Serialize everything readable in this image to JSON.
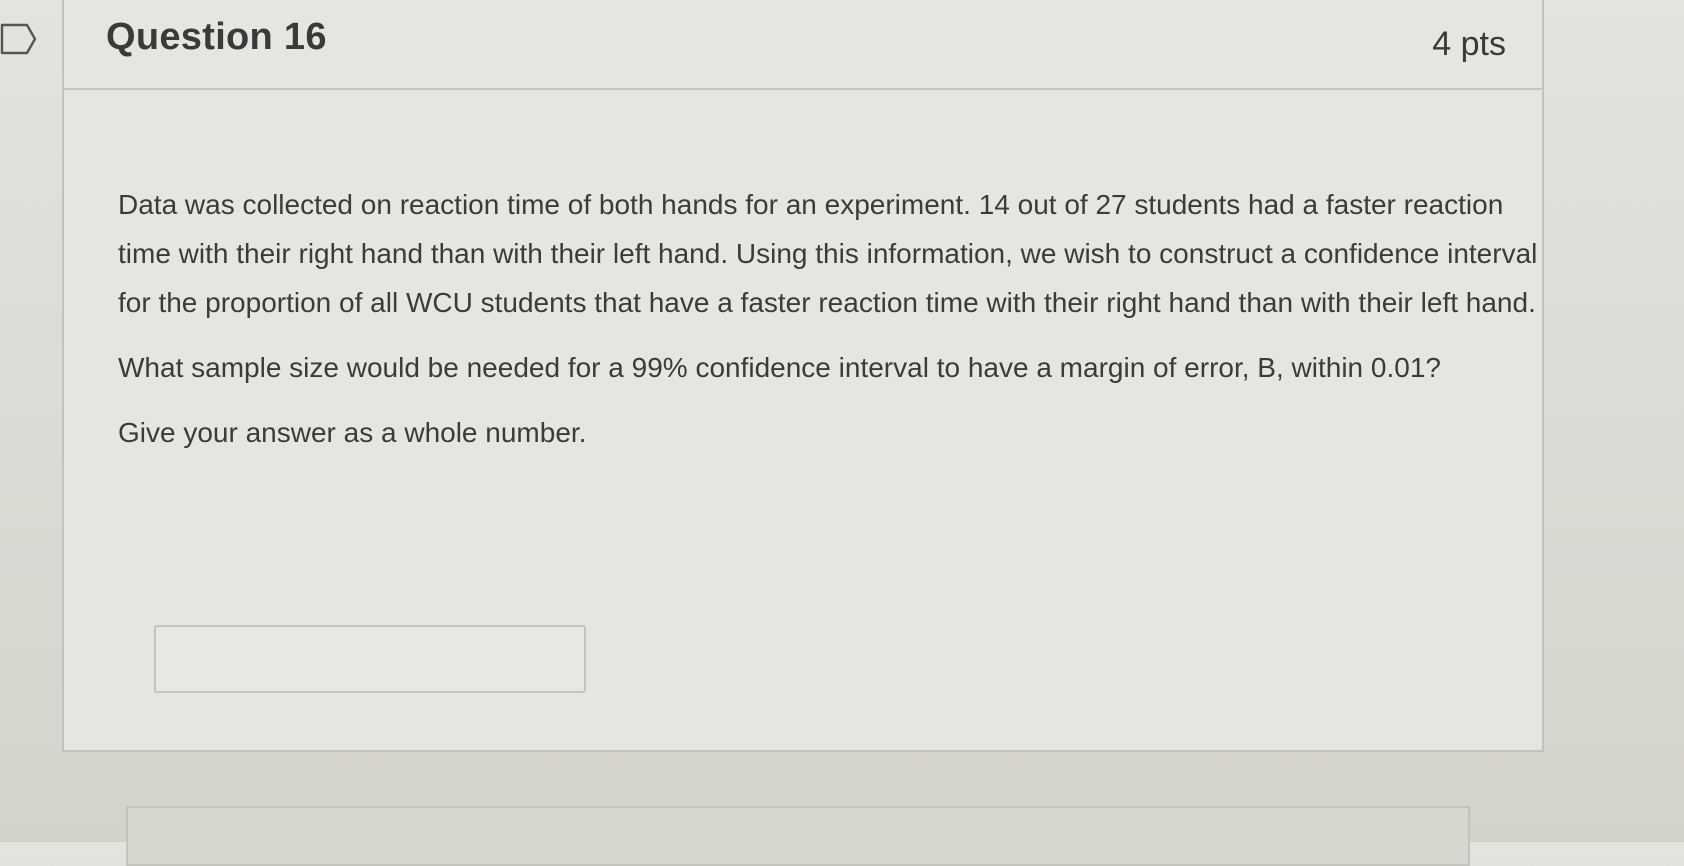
{
  "question": {
    "title": "Question 16",
    "points": "4 pts",
    "paragraphs": [
      "Data was collected on reaction time of both hands for an experiment. 14 out of 27 students had a faster reaction time with their right hand than with their left hand. Using this information, we wish to construct a confidence interval for the proportion of all WCU students that have a faster reaction time with their right hand than with their left hand.",
      "What sample size would be needed for a 99% confidence interval to have a margin of error, B, within 0.01?",
      "Give your answer as a whole number."
    ],
    "answer": {
      "value": "",
      "placeholder": ""
    }
  },
  "icons": {
    "flag": "bookmark-flag-icon"
  },
  "colors": {
    "background": "#dcdcd6",
    "card_border": "#c2c2bc",
    "text": "#3b3b3b"
  }
}
